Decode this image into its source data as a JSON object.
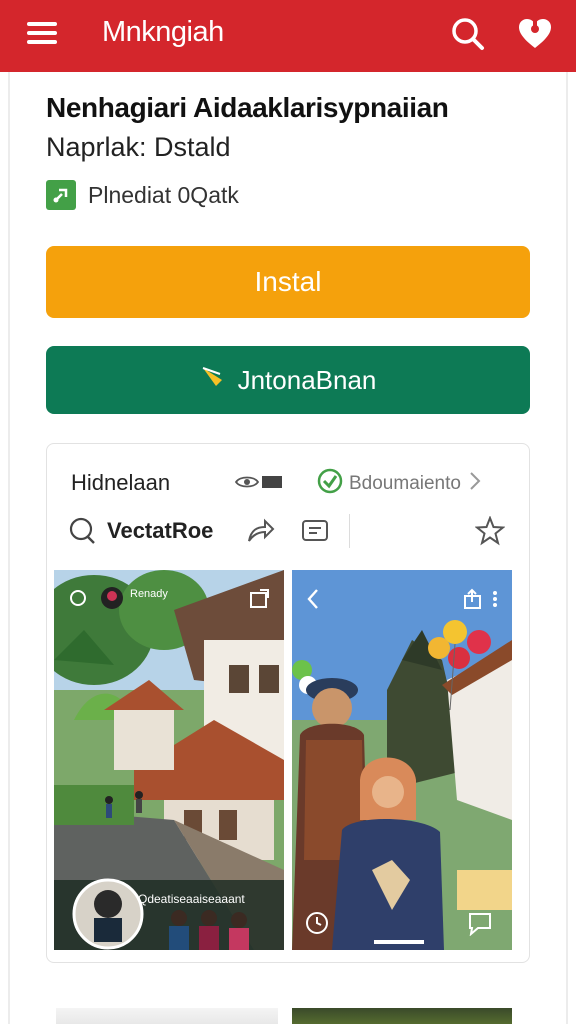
{
  "header": {
    "title": "Mnkngiah",
    "menu_icon": "menu-icon",
    "search_icon": "search-icon",
    "favorite_icon": "heart-icon",
    "color": "#d4262c"
  },
  "app": {
    "title": "Nenhagiari Aidaaklarisypnaiian",
    "subtitle": "Naprlak: Dstald",
    "meta_text": "Plnediat 0Qatk"
  },
  "buttons": {
    "install_label": "Instal",
    "install_color": "#f5a10c",
    "secondary_label": "JntonaBnan",
    "secondary_color": "#0d7a55"
  },
  "card": {
    "title": "Hidnelaan",
    "docs_label": "Bdoumaiento",
    "action_label": "VectatRoe",
    "photo1_caption": "Qdeatiseaaiseaaant",
    "photo1_tag": "Renady"
  }
}
